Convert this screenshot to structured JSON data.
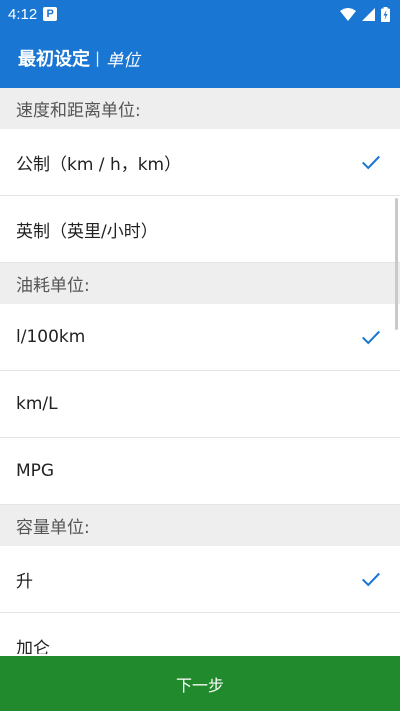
{
  "status_bar": {
    "time": "4:12",
    "notification_icon": "parking-p-icon",
    "icons": [
      "wifi-icon",
      "signal-icon",
      "battery-icon"
    ]
  },
  "app_bar": {
    "title": "最初设定",
    "separator": "|",
    "subtitle": "单位"
  },
  "sections": [
    {
      "header": "速度和距离单位:",
      "options": [
        {
          "label": "公制（km / h，km）",
          "selected": true
        },
        {
          "label": "英制（英里/小时）",
          "selected": false
        }
      ]
    },
    {
      "header": "油耗单位:",
      "options": [
        {
          "label": "l/100km",
          "selected": true
        },
        {
          "label": "km/L",
          "selected": false
        },
        {
          "label": "MPG",
          "selected": false
        }
      ]
    },
    {
      "header": "容量单位:",
      "options": [
        {
          "label": "升",
          "selected": true
        },
        {
          "label": "加仑",
          "selected": false
        }
      ]
    }
  ],
  "footer": {
    "next_label": "下一步"
  },
  "colors": {
    "primary": "#1976d2",
    "check": "#1976d2",
    "next_button": "#218a2d",
    "section_bg": "#eeeeee"
  }
}
